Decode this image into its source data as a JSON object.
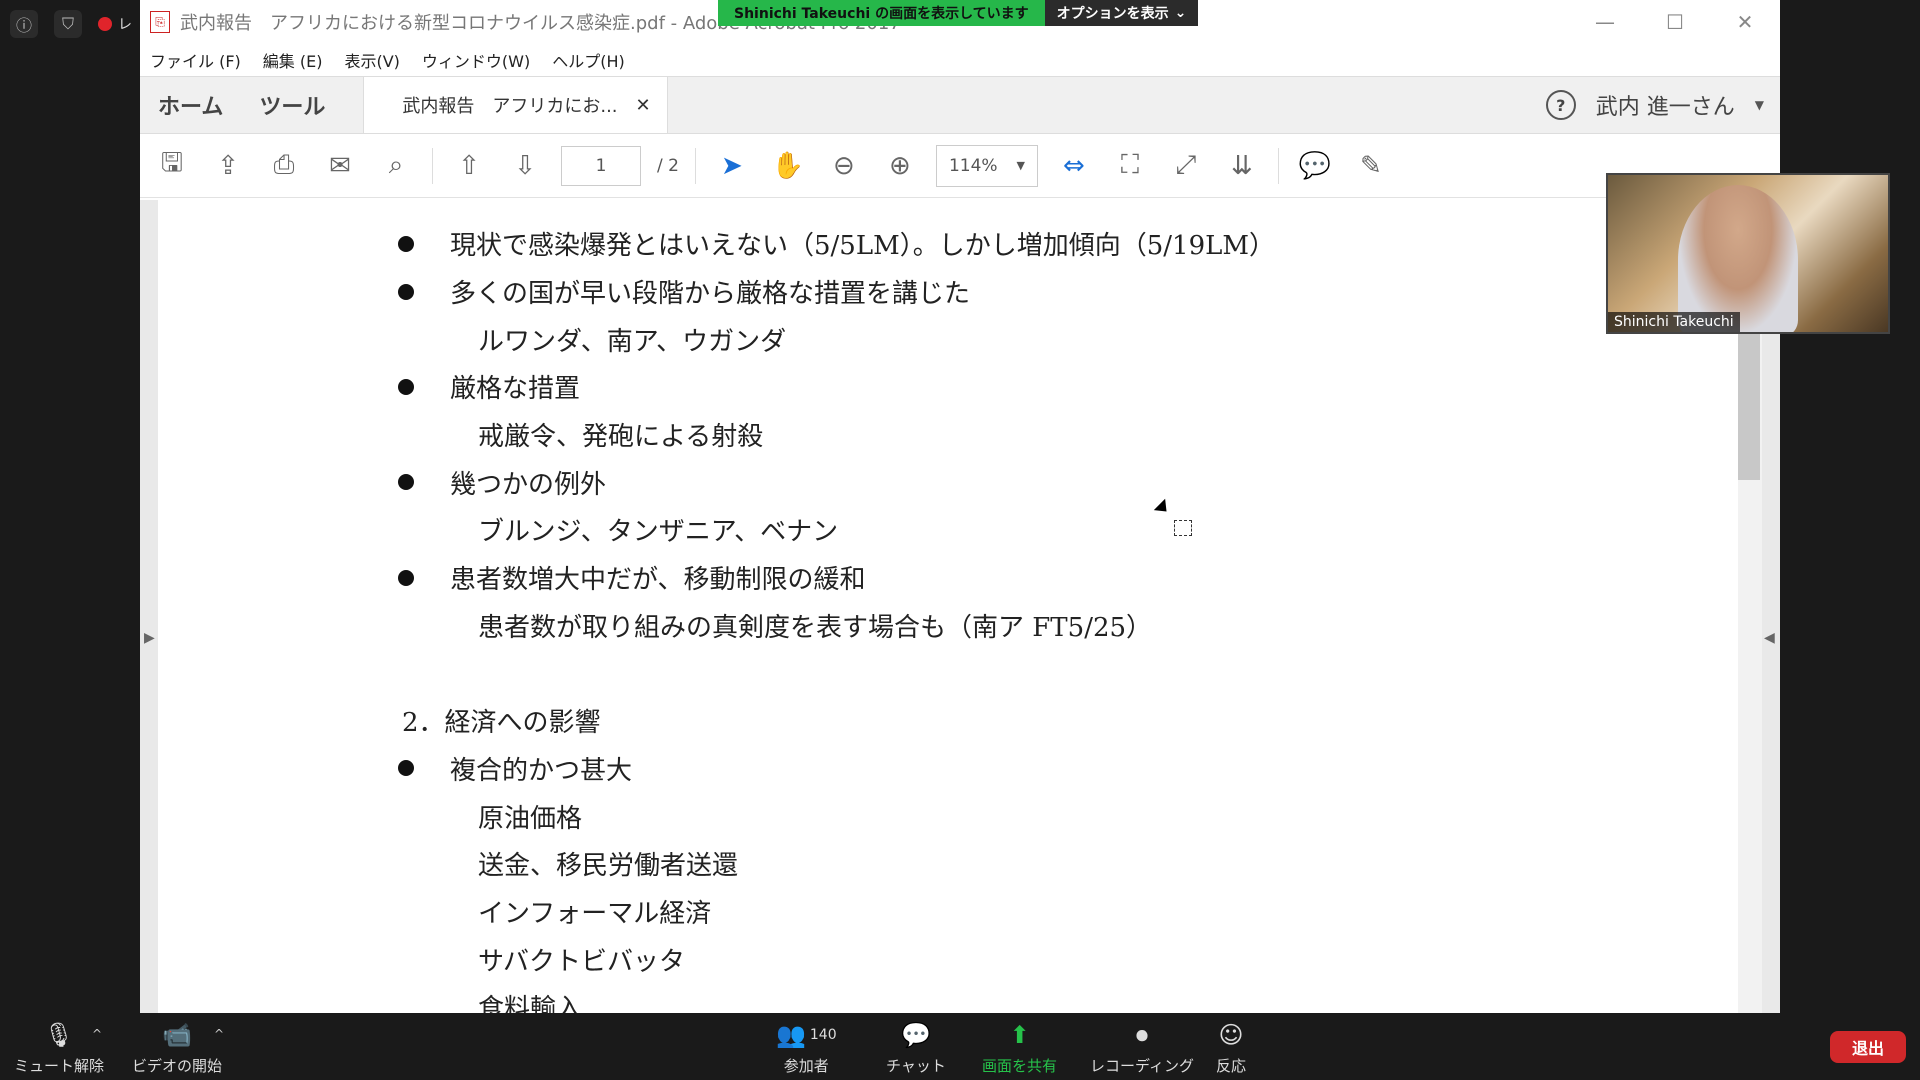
{
  "zoom": {
    "rec_label": "レ",
    "share_message": "Shinichi  Takeuchi の画面を表示しています",
    "options_label": "オプションを表示",
    "participant_name": "Shinichi Takeuchi",
    "participant_count": "140",
    "controls": {
      "mute": "ミュート解除",
      "video": "ビデオの開始",
      "participants": "参加者",
      "chat": "チャット",
      "share": "画面を共有",
      "record": "レコーディング",
      "reactions": "反応",
      "leave": "退出"
    }
  },
  "acrobat": {
    "window_title": "武内報告　アフリカにおける新型コロナウイルス感染症.pdf - Adobe Acrobat Pro 2017",
    "menu": [
      "ファイル (F)",
      "編集 (E)",
      "表示(V)",
      "ウィンドウ(W)",
      "ヘルプ(H)"
    ],
    "nav_tabs": [
      "ホーム",
      "ツール"
    ],
    "doc_tab": "武内報告　アフリカにお...",
    "user": "武内 進一さん",
    "page_current": "1",
    "page_total": "/  2",
    "zoom_level": "114%"
  },
  "document": {
    "lines": [
      {
        "type": "bullet",
        "text": "現状で感染爆発とはいえない（5/5LM）。しかし増加傾向（5/19LM）"
      },
      {
        "type": "bullet",
        "text": "多くの国が早い段階から厳格な措置を講じた"
      },
      {
        "type": "sub",
        "text": "ルワンダ、南ア、ウガンダ"
      },
      {
        "type": "bullet",
        "text": "厳格な措置"
      },
      {
        "type": "sub",
        "text": "戒厳令、発砲による射殺"
      },
      {
        "type": "bullet",
        "text": "幾つかの例外"
      },
      {
        "type": "sub",
        "text": "ブルンジ、タンザニア、ベナン"
      },
      {
        "type": "bullet",
        "text": "患者数増大中だが、移動制限の緩和"
      },
      {
        "type": "sub",
        "text": "患者数が取り組みの真剣度を表す場合も（南ア FT5/25）"
      },
      {
        "type": "blank",
        "text": ""
      },
      {
        "type": "section",
        "text": "2．経済への影響"
      },
      {
        "type": "bullet",
        "text": "複合的かつ甚大"
      },
      {
        "type": "sub",
        "text": "原油価格"
      },
      {
        "type": "sub",
        "text": "送金、移民労働者送還"
      },
      {
        "type": "sub",
        "text": "インフォーマル経済"
      },
      {
        "type": "sub",
        "text": "サバクトビバッタ"
      },
      {
        "type": "sub",
        "text": "食料輸入"
      }
    ]
  }
}
